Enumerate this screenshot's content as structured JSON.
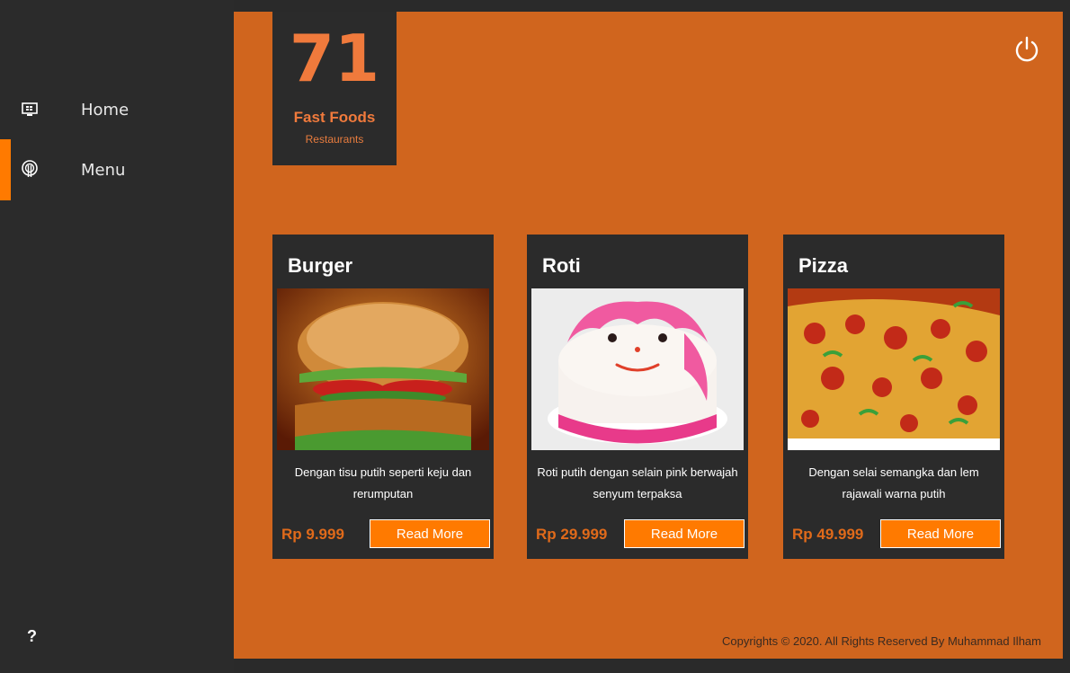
{
  "sidebar": {
    "items": [
      {
        "label": "Home",
        "icon": "monitor-icon",
        "active": false
      },
      {
        "label": "Menu",
        "icon": "restaurant-icon",
        "active": true
      }
    ],
    "help_label": "?",
    "accent": "#ff7a00"
  },
  "stat": {
    "number": "71",
    "title": "Fast Foods",
    "subtitle": "Restaurants"
  },
  "header": {
    "power_icon": "power-icon"
  },
  "cards": [
    {
      "title": "Burger",
      "image": "burger-image",
      "description": "Dengan tisu putih seperti keju dan rerumputan",
      "price": "Rp 9.999",
      "button": "Read More"
    },
    {
      "title": "Roti",
      "image": "cake-image",
      "description": "Roti putih dengan selain pink berwajah senyum terpaksa",
      "price": "Rp 29.999",
      "button": "Read More"
    },
    {
      "title": "Pizza",
      "image": "pizza-image",
      "description": "Dengan selai semangka dan lem rajawali warna putih",
      "price": "Rp 49.999",
      "button": "Read More"
    }
  ],
  "footer": {
    "copyright": "Copyrights © 2020. All Rights Reserved By Muhammad Ilham"
  },
  "colors": {
    "main_bg": "#d0651e",
    "panel": "#2b2b2b",
    "button": "#ff7a00",
    "stat_text": "#f07a3c"
  }
}
